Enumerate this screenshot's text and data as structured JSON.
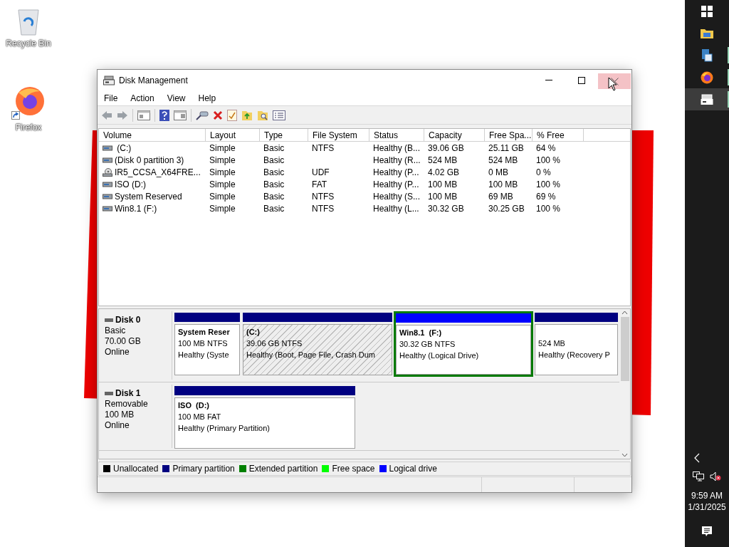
{
  "desktop_icons": [
    {
      "label": "Recycle Bin",
      "kind": "recycle",
      "shortcut": false
    },
    {
      "label": "Firefox",
      "kind": "firefox",
      "shortcut": true
    }
  ],
  "window": {
    "title": "Disk Management",
    "close_hovered": true
  },
  "menu": [
    "File",
    "Action",
    "View",
    "Help"
  ],
  "volume_table": {
    "columns": [
      "Volume",
      "Layout",
      "Type",
      "File System",
      "Status",
      "Capacity",
      "Free Spa...",
      "% Free"
    ],
    "rows": [
      {
        "kind": "drive",
        "cells": [
          " (C:)",
          "Simple",
          "Basic",
          "NTFS",
          "Healthy (B...",
          "39.06 GB",
          "25.11 GB",
          "64 %"
        ]
      },
      {
        "kind": "drive",
        "cells": [
          "(Disk 0 partition 3)",
          "Simple",
          "Basic",
          "",
          "Healthy (R...",
          "524 MB",
          "524 MB",
          "100 %"
        ]
      },
      {
        "kind": "cd",
        "cells": [
          "IR5_CCSA_X64FRE...",
          "Simple",
          "Basic",
          "UDF",
          "Healthy (P...",
          "4.02 GB",
          "0 MB",
          "0 %"
        ]
      },
      {
        "kind": "drive",
        "cells": [
          "ISO (D:)",
          "Simple",
          "Basic",
          "FAT",
          "Healthy (P...",
          "100 MB",
          "100 MB",
          "100 %"
        ]
      },
      {
        "kind": "drive",
        "cells": [
          "System Reserved",
          "Simple",
          "Basic",
          "NTFS",
          "Healthy (S...",
          "100 MB",
          "69 MB",
          "69 %"
        ]
      },
      {
        "kind": "drive",
        "cells": [
          "Win8.1 (F:)",
          "Simple",
          "Basic",
          "NTFS",
          "Healthy (L...",
          "30.32 GB",
          "30.25 GB",
          "100 %"
        ]
      }
    ]
  },
  "disks": [
    {
      "name": "Disk 0",
      "type": "Basic",
      "size": "70.00 GB",
      "status": "Online",
      "partitions": [
        {
          "name": "System Reser",
          "size": "100 MB NTFS",
          "status": "Healthy (Syste",
          "kind": "primary",
          "selected": false,
          "extended": false
        },
        {
          "name": "(C:)",
          "size": "39.06 GB NTFS",
          "status": "Healthy (Boot, Page File, Crash Dum",
          "kind": "primary",
          "selected": true,
          "extended": false
        },
        {
          "name": "Win8.1  (F:)",
          "size": "30.32 GB NTFS",
          "status": "Healthy (Logical Drive)",
          "kind": "logical",
          "selected": false,
          "extended": true
        },
        {
          "size": "524 MB",
          "status": "Healthy (Recovery P",
          "kind": "primary",
          "selected": false,
          "extended": false
        }
      ]
    },
    {
      "name": "Disk 1",
      "type": "Removable",
      "size": "100 MB",
      "status": "Online",
      "partitions": [
        {
          "name": "ISO  (D:)",
          "size": "100 MB FAT",
          "status": "Healthy (Primary Partition)",
          "kind": "primary",
          "selected": false,
          "extended": false
        }
      ]
    }
  ],
  "legend": [
    {
      "label": "Unallocated",
      "color": "#000000"
    },
    {
      "label": "Primary partition",
      "color": "#000080"
    },
    {
      "label": "Extended partition",
      "color": "#008000"
    },
    {
      "label": "Free space",
      "color": "#00ff00"
    },
    {
      "label": "Logical drive",
      "color": "#0000ff"
    }
  ],
  "taskbar": {
    "items": [
      {
        "kind": "start",
        "running": false,
        "selected": false
      },
      {
        "kind": "folder",
        "running": false,
        "selected": false
      },
      {
        "kind": "document",
        "running": true,
        "selected": false
      },
      {
        "kind": "firefox",
        "running": true,
        "selected": false
      },
      {
        "kind": "disk",
        "running": true,
        "selected": true
      }
    ],
    "time": "9:59 AM",
    "date": "1/31/2025"
  }
}
